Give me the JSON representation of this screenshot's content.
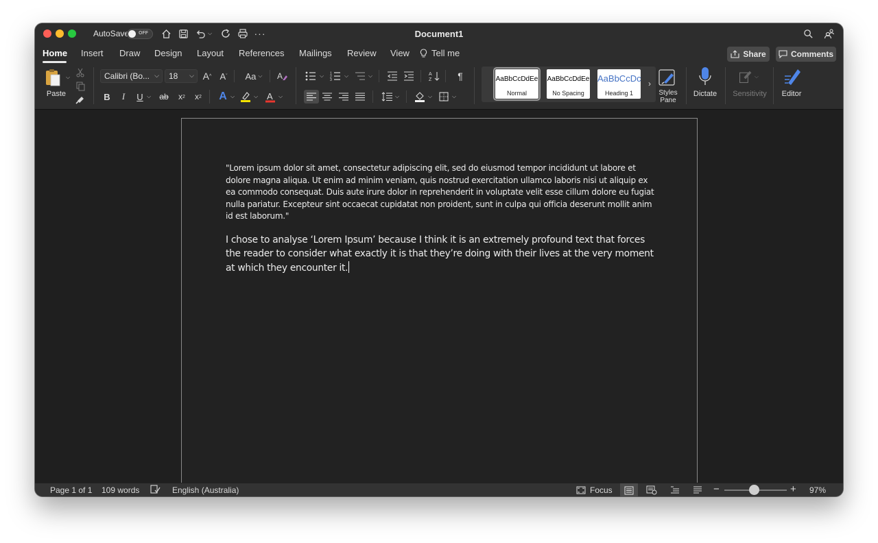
{
  "titlebar": {
    "autosave_label": "AutoSave",
    "autosave_state": "OFF",
    "doc_title": "Document1"
  },
  "tabs": [
    {
      "label": "Home",
      "active": true
    },
    {
      "label": "Insert"
    },
    {
      "label": "Draw"
    },
    {
      "label": "Design"
    },
    {
      "label": "Layout"
    },
    {
      "label": "References"
    },
    {
      "label": "Mailings"
    },
    {
      "label": "Review"
    },
    {
      "label": "View"
    },
    {
      "label": "Tell me"
    }
  ],
  "header_buttons": {
    "share": "Share",
    "comments": "Comments"
  },
  "ribbon": {
    "paste_label": "Paste",
    "font_name": "Calibri (Bo...",
    "font_size": "18",
    "change_case": "Aa",
    "styles": [
      {
        "sample": "AaBbCcDdEe",
        "name": "Normal",
        "selected": true
      },
      {
        "sample": "AaBbCcDdEe",
        "name": "No Spacing"
      },
      {
        "sample": "AaBbCcDc",
        "name": "Heading 1",
        "color": "#4472c4"
      }
    ],
    "styles_pane": "Styles Pane",
    "styles_pane_line1": "Styles",
    "styles_pane_line2": "Pane",
    "dictate": "Dictate",
    "sensitivity": "Sensitivity",
    "editor": "Editor",
    "colors": {
      "highlight": "#f5e400",
      "font_red": "#e8372f",
      "text_effects": "#4f86e8",
      "dictate_blue": "#4f86e8"
    }
  },
  "document": {
    "paragraph1": "\"Lorem ipsum dolor sit amet, consectetur adipiscing elit, sed do eiusmod tempor incididunt ut labore et dolore magna aliqua. Ut enim ad minim veniam, quis nostrud exercitation ullamco laboris nisi ut aliquip ex ea commodo consequat. Duis aute irure dolor in reprehenderit in voluptate velit esse cillum dolore eu fugiat nulla pariatur. Excepteur sint occaecat cupidatat non proident, sunt in culpa qui officia deserunt mollit anim id est laborum.\"",
    "paragraph2": "I chose to analyse ‘Lorem Ipsum’ because I think it is an extremely profound text that forces the reader to consider what exactly it is that they’re doing with their lives at the very moment at which they encounter it."
  },
  "statusbar": {
    "page": "Page 1 of 1",
    "words": "109 words",
    "language": "English (Australia)",
    "focus": "Focus",
    "zoom": "97%"
  }
}
